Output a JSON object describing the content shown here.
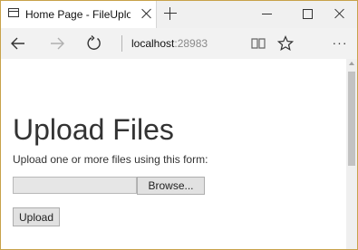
{
  "browser": {
    "tab": {
      "title": "Home Page - FileUploac",
      "icon": "page-icon"
    },
    "address_bar": {
      "host": "localhost",
      "port": ":28983"
    },
    "more_label": "···"
  },
  "page": {
    "heading": "Upload Files",
    "description": "Upload one or more files using this form:",
    "file_input": {
      "browse_label": "Browse...",
      "value": ""
    },
    "upload_label": "Upload"
  },
  "colors": {
    "window_border": "#c8a24a",
    "chrome_bg": "#f0f0f0",
    "button_bg": "#e1e1e1",
    "text": "#333333"
  }
}
